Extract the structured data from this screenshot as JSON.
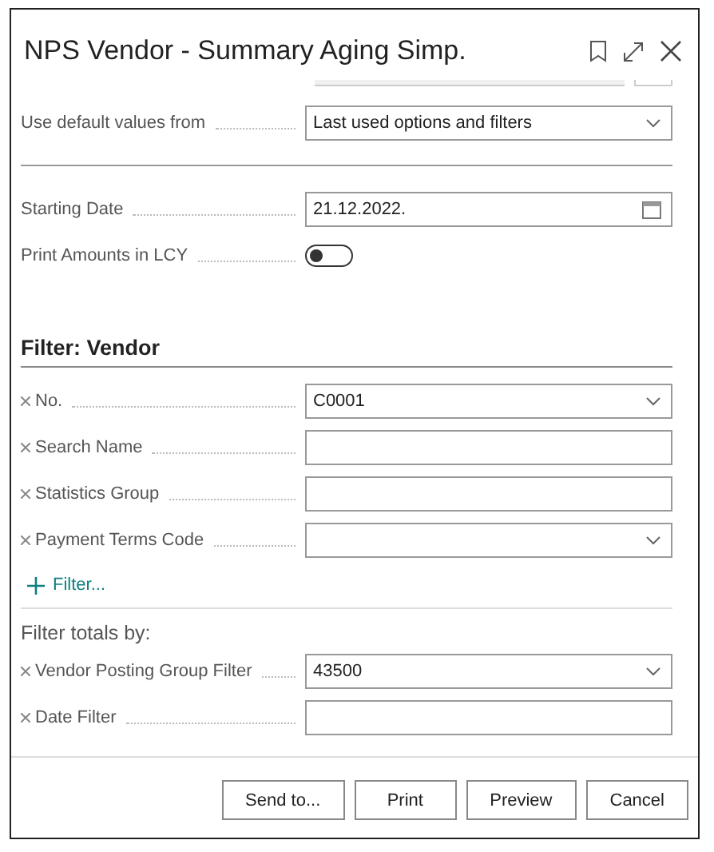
{
  "window": {
    "title": "NPS Vendor - Summary Aging Simp."
  },
  "options": [
    {
      "kind": "dropdown",
      "label": "Use default values from",
      "value": "Last used options and filters"
    }
  ],
  "fields": [
    {
      "kind": "date",
      "label": "Starting Date",
      "value": "21.12.2022."
    },
    {
      "kind": "toggle",
      "label": "Print Amounts in LCY",
      "on": false
    }
  ],
  "vendor_filter": {
    "title": "Filter: Vendor",
    "fields": [
      {
        "kind": "dropdown",
        "label": "No.",
        "value": "C0001"
      },
      {
        "kind": "text",
        "label": "Search Name"
      },
      {
        "kind": "text",
        "label": "Statistics Group"
      },
      {
        "kind": "dropdown",
        "label": "Payment Terms Code"
      }
    ],
    "add_filter": "Filter..."
  },
  "totals_filter": {
    "title": "Filter totals by:",
    "fields": [
      {
        "kind": "dropdown",
        "label": "Vendor Posting Group Filter",
        "value": "43500"
      },
      {
        "kind": "text",
        "label": "Date Filter"
      }
    ]
  },
  "buttons": [
    "Send to...",
    "Print",
    "Preview",
    "Cancel"
  ]
}
